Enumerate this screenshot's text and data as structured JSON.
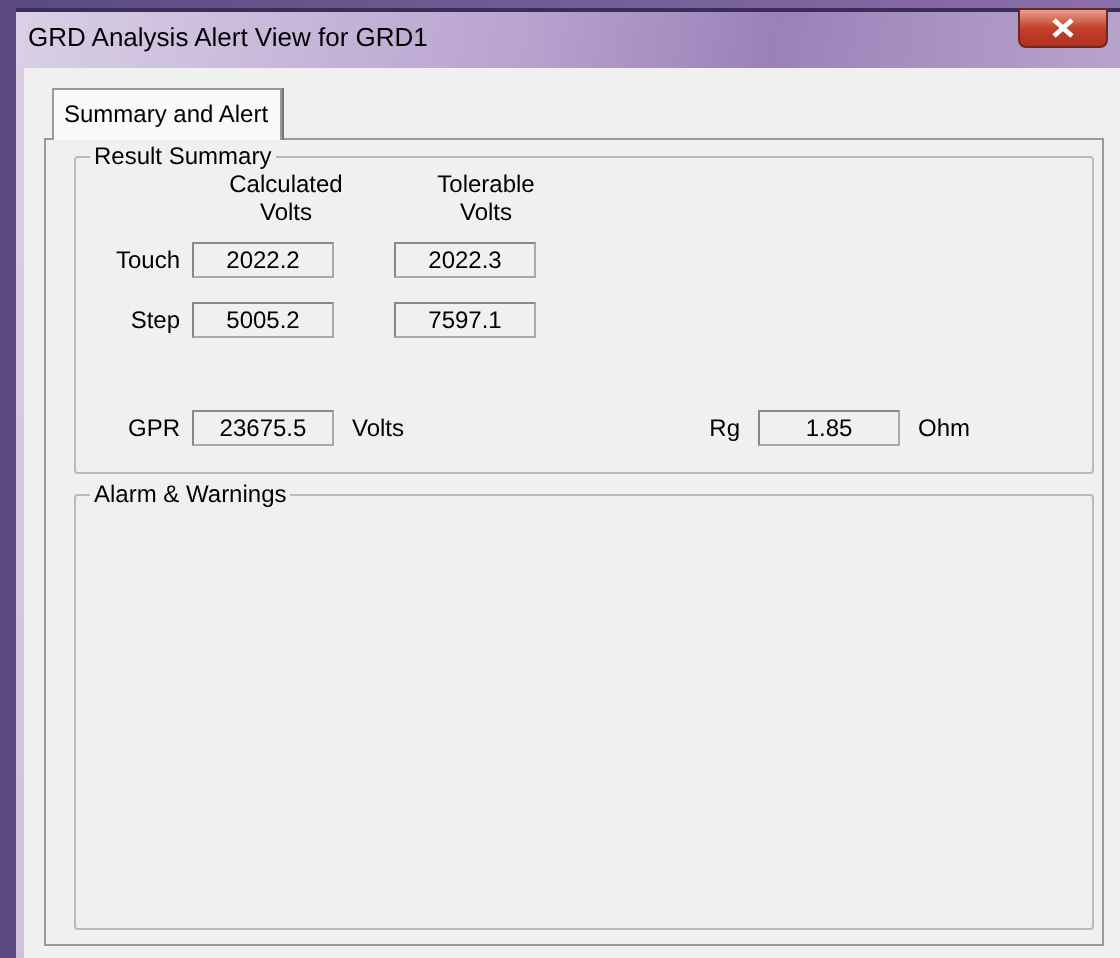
{
  "window": {
    "title": "GRD Analysis Alert View for GRD1"
  },
  "tabs": [
    {
      "label": "Summary and Alert",
      "selected": true
    }
  ],
  "result_summary": {
    "title": "Result Summary",
    "column_headers": [
      "Calculated\nVolts",
      "Tolerable\nVolts"
    ],
    "rows": [
      {
        "label": "Touch",
        "calculated": "2022.2",
        "tolerable": "2022.3"
      },
      {
        "label": "Step",
        "calculated": "5005.2",
        "tolerable": "7597.1"
      }
    ],
    "gpr": {
      "label": "GPR",
      "value": "23675.5",
      "unit": "Volts"
    },
    "rg": {
      "label": "Rg",
      "value": "1.85",
      "unit": "Ohm"
    }
  },
  "alarms": {
    "title": "Alarm & Warnings"
  }
}
